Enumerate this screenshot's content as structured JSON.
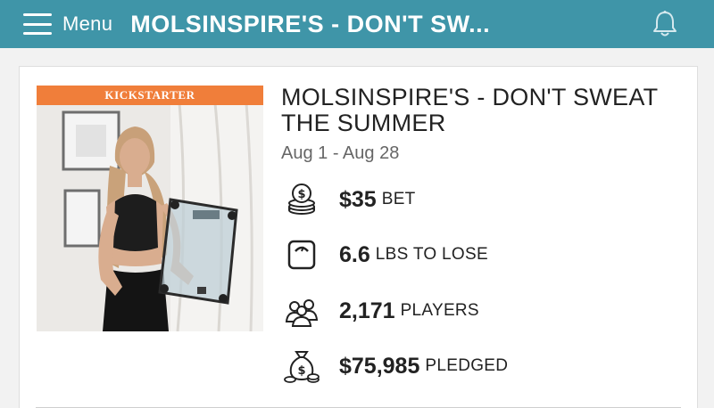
{
  "header": {
    "menu_label": "Menu",
    "title": "MOLSINSPIRE'S - DON'T SW...",
    "bar_color": "#3f95a8",
    "bell_icon": "bell-icon",
    "menu_icon": "hamburger-icon"
  },
  "game": {
    "badge": "KICKSTARTER",
    "badge_color": "#f07e3a",
    "title": "MOLSINSPIRE'S - DON'T SWEAT THE SUMMER",
    "dates": "Aug 1 - Aug 28",
    "stats": [
      {
        "icon": "coins-icon",
        "value": "$35",
        "label": "BET"
      },
      {
        "icon": "scale-icon",
        "value": "6.6",
        "label": "LBS TO LOSE"
      },
      {
        "icon": "players-icon",
        "value": "2,171",
        "label": "PLAYERS"
      },
      {
        "icon": "money-bag-icon",
        "value": "$75,985",
        "label": "PLEDGED"
      }
    ]
  }
}
